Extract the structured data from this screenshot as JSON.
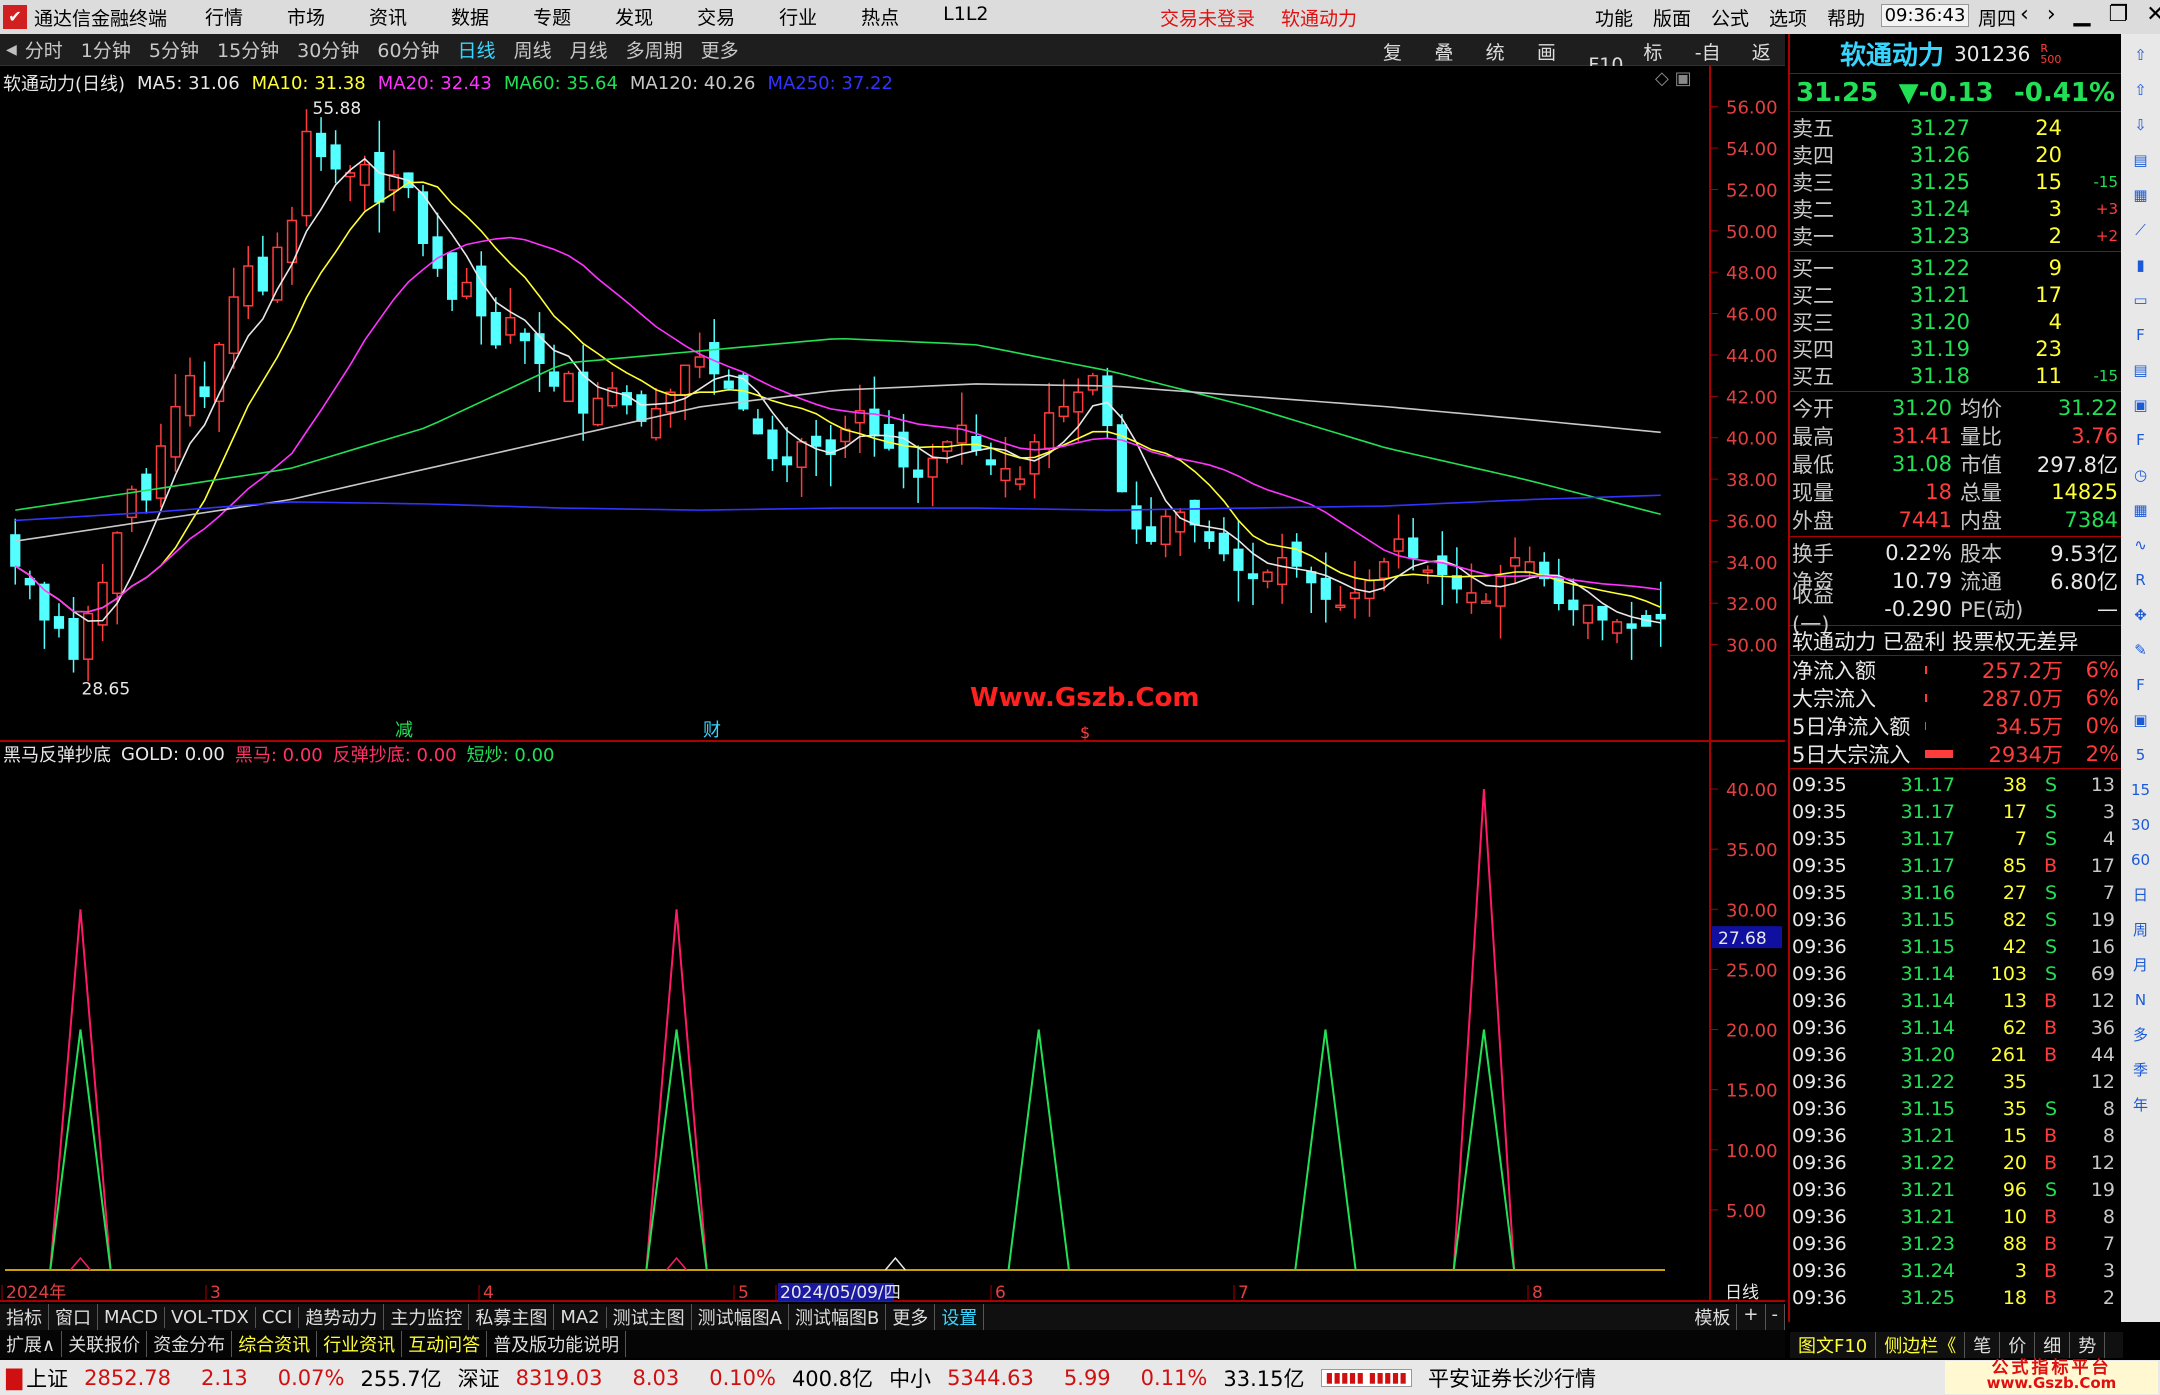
{
  "window": {
    "app_title": "通达信金融终端",
    "menus": [
      "行情",
      "市场",
      "资讯",
      "数据",
      "专题",
      "发现",
      "交易",
      "行业",
      "热点",
      "L1L2"
    ],
    "login_status": "交易未登录",
    "stock_title": "软通动力",
    "right_menus": [
      "功能",
      "版面",
      "公式",
      "选项",
      "帮助"
    ],
    "time": "09:36:43",
    "weekday": "周四"
  },
  "periods": [
    "分时",
    "1分钟",
    "5分钟",
    "15分钟",
    "30分钟",
    "60分钟",
    "日线",
    "周线",
    "月线",
    "多周期",
    "更多"
  ],
  "active_period": "日线",
  "tools": [
    "复权",
    "叠加",
    "统计",
    "画线",
    "F10",
    "标记",
    "-自选",
    "返回"
  ],
  "main_chart": {
    "stock_label": "软通动力(日线)",
    "ma": [
      {
        "name": "MA5: 31.06",
        "color": "#e8e8e8"
      },
      {
        "name": "MA10: 31.38",
        "color": "#ffff33"
      },
      {
        "name": "MA20: 32.43",
        "color": "#ff33ff"
      },
      {
        "name": "MA60: 35.64",
        "color": "#22e055"
      },
      {
        "name": "MA120: 40.26",
        "color": "#c8c8c8"
      },
      {
        "name": "MA250: 37.22",
        "color": "#3333ff"
      }
    ],
    "high_label": "55.88",
    "low_label": "28.65",
    "y_ticks": [
      "56.00",
      "54.00",
      "52.00",
      "50.00",
      "48.00",
      "46.00",
      "44.00",
      "42.00",
      "40.00",
      "38.00",
      "36.00",
      "34.00",
      "32.00",
      "30.00"
    ],
    "y_values": [
      56,
      54,
      52,
      50,
      48,
      46,
      44,
      42,
      40,
      38,
      36,
      34,
      32,
      30
    ],
    "markers": [
      "减",
      "财",
      "$"
    ],
    "watermark": "Www.Gszb.Com"
  },
  "chart_data": [
    {
      "type": "candlestick",
      "title": "软通动力(日线)",
      "ylim": [
        28,
        57
      ],
      "ma_series": [
        "MA5",
        "MA10",
        "MA20",
        "MA60",
        "MA120",
        "MA250"
      ],
      "high": 55.88,
      "low": 28.65,
      "closes": [
        33.8,
        32.9,
        31.2,
        30.8,
        29.3,
        31.5,
        33.0,
        35.4,
        37.5,
        37.0,
        39.6,
        41.5,
        43.0,
        42.0,
        44.5,
        46.8,
        48.3,
        47.1,
        49.2,
        50.5,
        54.8,
        53.6,
        53.0,
        52.8,
        53.2,
        51.4,
        52.7,
        52.1,
        49.4,
        48.2,
        46.7,
        47.5,
        45.9,
        44.5,
        45.8,
        44.7,
        43.6,
        42.5,
        43.1,
        41.2,
        41.9,
        42.4,
        41.6,
        40.8,
        41.4,
        42.2,
        43.5,
        43.9,
        43.1,
        42.4,
        41.4,
        40.2,
        39.0,
        38.7,
        39.8,
        39.6,
        39.2,
        40.4,
        41.3,
        40.1,
        39.5,
        38.6,
        38.1,
        39.0,
        39.8,
        40.6,
        39.4,
        38.7,
        38.5,
        38.0,
        39.8,
        41.2,
        41.5,
        42.2,
        43.0,
        40.6,
        37.4,
        35.6,
        35.0,
        36.2,
        36.4,
        35.8,
        35.0,
        34.4,
        33.6,
        33.2,
        33.5,
        34.2,
        33.8,
        33.0,
        32.2,
        31.9,
        32.5,
        33.1,
        34.0,
        35.1,
        34.2,
        33.6,
        33.4,
        32.7,
        32.5,
        32.1,
        33.3,
        34.2,
        34.0,
        33.2,
        32.0,
        31.7,
        31.9,
        31.2,
        31.1,
        30.8,
        30.9,
        31.25
      ]
    },
    {
      "type": "line",
      "title": "黑马反弹抄底",
      "indicators": [
        "GOLD: 0.00",
        "黑马: 0.00",
        "反弹抄底: 0.00",
        "短炒: 0.00"
      ],
      "ylim": [
        0,
        42
      ],
      "y_ticks": [
        "40.00",
        "35.00",
        "30.00",
        "25.00",
        "20.00",
        "15.00",
        "10.00",
        "5.00"
      ],
      "y_values": [
        40,
        35,
        30,
        25,
        20,
        15,
        10,
        5
      ],
      "current_label": "27.68",
      "series": [
        {
          "name": "黑马",
          "spikes": [
            {
              "x_index": 10,
              "value": 30
            },
            {
              "x_index": 89,
              "value": 30
            },
            {
              "x_index": 196,
              "value": 40
            }
          ]
        },
        {
          "name": "短炒",
          "spikes": [
            {
              "x_index": 10,
              "value": 20
            },
            {
              "x_index": 89,
              "value": 20
            },
            {
              "x_index": 137,
              "value": 20
            },
            {
              "x_index": 175,
              "value": 20
            },
            {
              "x_index": 196,
              "value": 20
            }
          ]
        }
      ],
      "x_labels": [
        "2024年",
        "3",
        "4",
        "5",
        "2024/05/09/四",
        "6",
        "7",
        "8",
        "日线"
      ]
    }
  ],
  "bottom_tabs": [
    "指标",
    "窗口",
    "MACD",
    "VOL-TDX",
    "CCI",
    "趋势动力",
    "主力监控",
    "私募主图",
    "MA2",
    "测试主图",
    "测试幅图A",
    "测试幅图B",
    "更多",
    "设置"
  ],
  "bottom_tabs_right": [
    "模板",
    "+",
    "-"
  ],
  "bottom_links": [
    "扩展∧",
    "关联报价",
    "资金分布",
    "综合资讯",
    "行业资讯",
    "互动问答",
    "普及版功能说明"
  ],
  "right_panel": {
    "name": "软通动力",
    "code": "301236",
    "badge_top": "R",
    "badge_bottom": "500",
    "price": "31.25",
    "change": "▼-0.13",
    "pct": "-0.41%",
    "asks": [
      {
        "label": "卖五",
        "p": "31.27",
        "v": "24",
        "d": ""
      },
      {
        "label": "卖四",
        "p": "31.26",
        "v": "20",
        "d": ""
      },
      {
        "label": "卖三",
        "p": "31.25",
        "v": "15",
        "d": "-15"
      },
      {
        "label": "卖二",
        "p": "31.24",
        "v": "3",
        "d": "+3"
      },
      {
        "label": "卖一",
        "p": "31.23",
        "v": "2",
        "d": "+2"
      }
    ],
    "bids": [
      {
        "label": "买一",
        "p": "31.22",
        "v": "9",
        "d": ""
      },
      {
        "label": "买二",
        "p": "31.21",
        "v": "17",
        "d": ""
      },
      {
        "label": "买三",
        "p": "31.20",
        "v": "4",
        "d": ""
      },
      {
        "label": "买四",
        "p": "31.19",
        "v": "23",
        "d": ""
      },
      {
        "label": "买五",
        "p": "31.18",
        "v": "11",
        "d": "-15"
      }
    ],
    "stats": [
      [
        "今开",
        "31.20",
        "均价",
        "31.22"
      ],
      [
        "最高",
        "31.41",
        "量比",
        "3.76"
      ],
      [
        "最低",
        "31.08",
        "市值",
        "297.8亿"
      ],
      [
        "现量",
        "18",
        "总量",
        "14825"
      ],
      [
        "外盘",
        "7441",
        "内盘",
        "7384"
      ]
    ],
    "stats2": [
      [
        "换手",
        "0.22%",
        "股本",
        "9.53亿"
      ],
      [
        "净资",
        "10.79",
        "流通",
        "6.80亿"
      ],
      [
        "收益(一)",
        "-0.290",
        "PE(动)",
        "—"
      ]
    ],
    "tags": "软通动力 已盈利 投票权无差异",
    "flows": [
      [
        "净流入额",
        "257.2万",
        "6%"
      ],
      [
        "大宗流入",
        "287.0万",
        "6%"
      ],
      [
        "5日净流入额",
        "34.5万",
        "0%"
      ],
      [
        "5日大宗流入",
        "2934万",
        "2%"
      ]
    ],
    "ticks": [
      [
        "09:35",
        "31.17",
        "38",
        "S",
        "13"
      ],
      [
        "09:35",
        "31.17",
        "17",
        "S",
        "3"
      ],
      [
        "09:35",
        "31.17",
        "7",
        "S",
        "4"
      ],
      [
        "09:35",
        "31.17",
        "85",
        "B",
        "17"
      ],
      [
        "09:35",
        "31.16",
        "27",
        "S",
        "7"
      ],
      [
        "09:36",
        "31.15",
        "82",
        "S",
        "19"
      ],
      [
        "09:36",
        "31.15",
        "42",
        "S",
        "16"
      ],
      [
        "09:36",
        "31.14",
        "103",
        "S",
        "69"
      ],
      [
        "09:36",
        "31.14",
        "13",
        "B",
        "12"
      ],
      [
        "09:36",
        "31.14",
        "62",
        "B",
        "36"
      ],
      [
        "09:36",
        "31.20",
        "261",
        "B",
        "44"
      ],
      [
        "09:36",
        "31.22",
        "35",
        "",
        "12"
      ],
      [
        "09:36",
        "31.15",
        "35",
        "S",
        "8"
      ],
      [
        "09:36",
        "31.21",
        "15",
        "B",
        "8"
      ],
      [
        "09:36",
        "31.22",
        "20",
        "B",
        "12"
      ],
      [
        "09:36",
        "31.21",
        "96",
        "S",
        "19"
      ],
      [
        "09:36",
        "31.21",
        "10",
        "B",
        "8"
      ],
      [
        "09:36",
        "31.23",
        "88",
        "B",
        "7"
      ],
      [
        "09:36",
        "31.24",
        "3",
        "B",
        "3"
      ],
      [
        "09:36",
        "31.25",
        "18",
        "B",
        "2"
      ]
    ],
    "bottom_tabs": [
      "图文F10",
      "侧边栏《",
      "笔",
      "价",
      "细",
      "势"
    ]
  },
  "side_icons": [
    "日",
    "周",
    "月",
    "N",
    "多",
    "季",
    "年"
  ],
  "status": {
    "sh_label": "上证",
    "sh": "2852.78",
    "sh_chg": "2.13",
    "sh_pct": "0.07%",
    "sh_amt": "255.7亿",
    "sz_label": "深证",
    "sz": "8319.03",
    "sz_chg": "8.03",
    "sz_pct": "0.10%",
    "sz_amt": "400.8亿",
    "zx_label": "中小",
    "zx": "5344.63",
    "zx_chg": "5.99",
    "zx_pct": "0.11%",
    "zx_amt": "33.15亿",
    "broker": "平安证券长沙行情",
    "logo": "公式指标平台",
    "logo_url": "www.Gszb.Com"
  }
}
